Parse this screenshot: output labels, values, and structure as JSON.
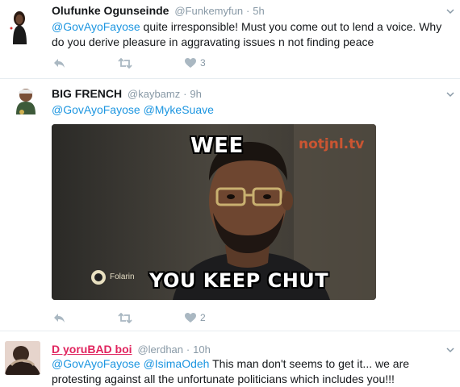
{
  "tweets": [
    {
      "name": "Olufunke Ogunseinde",
      "handle": "@Funkemyfun",
      "dot": "·",
      "time": "5h",
      "mention": "@GovAyoFayose",
      "text": " quite irresponsible! Must you come out to lend a voice. Why do you derive pleasure in aggravating issues n not finding peace",
      "likes": "3"
    },
    {
      "name": "BIG FRENCH",
      "handle": "@kaybamz",
      "dot": "·",
      "time": "9h",
      "mention1": "@GovAyoFayose",
      "mention2": "@MykeSuave",
      "likes": "2",
      "image": {
        "top_text": "WEE",
        "bottom_text": "YOU KEEP CHUT",
        "watermark": "notjnl.tv",
        "tag": "Folarin"
      }
    },
    {
      "name": "D yoruBAD boi",
      "handle": "@lerdhan",
      "dot": "·",
      "time": "10h",
      "mention1": "@GovAyoFayose",
      "mention2": "@IsimaOdeh",
      "text": "  This man don't seems to get it... we are protesting against all the unfortunate politicians which includes you!!!"
    }
  ],
  "colors": {
    "mention": "#1b95e0",
    "meta": "#8899a6",
    "divider": "#e6ecf0",
    "red_name": "#e0245e"
  },
  "icons": [
    "reply-icon",
    "retweet-icon",
    "like-icon",
    "chevron-down-icon"
  ]
}
